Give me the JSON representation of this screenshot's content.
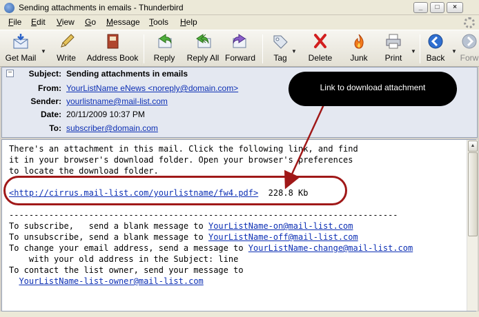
{
  "window": {
    "title": "Sending attachments in emails - Thunderbird",
    "minimize_glyph": "_",
    "maximize_glyph": "□",
    "close_glyph": "×"
  },
  "menu": [
    {
      "label": "File",
      "mnemonic": "F",
      "rest": "ile"
    },
    {
      "label": "Edit",
      "mnemonic": "E",
      "rest": "dit"
    },
    {
      "label": "View",
      "mnemonic": "V",
      "rest": "iew"
    },
    {
      "label": "Go",
      "mnemonic": "G",
      "rest": "o"
    },
    {
      "label": "Message",
      "mnemonic": "M",
      "rest": "essage"
    },
    {
      "label": "Tools",
      "mnemonic": "T",
      "rest": "ools"
    },
    {
      "label": "Help",
      "mnemonic": "H",
      "rest": "elp"
    }
  ],
  "toolbar": {
    "get_mail": "Get Mail",
    "write": "Write",
    "address_book": "Address Book",
    "reply": "Reply",
    "reply_all": "Reply All",
    "forward": "Forward",
    "tag": "Tag",
    "delete": "Delete",
    "junk": "Junk",
    "print": "Print",
    "back": "Back",
    "forward_nav": "Forw"
  },
  "header": {
    "subject_label": "Subject:",
    "subject": "Sending attachments in emails",
    "from_label": "From:",
    "from": "YourListName eNews <noreply@domain.com>",
    "sender_label": "Sender:",
    "sender": "yourlistname@mail-list.com",
    "date_label": "Date:",
    "date": "20/11/2009 10:37 PM",
    "to_label": "To:",
    "to": "subscriber@domain.com"
  },
  "body": {
    "line1": "There's an attachment in this mail. Click the following link, and find",
    "line2": "it in your browser's download folder. Open your browser's preferences",
    "line3": "to locate the download folder.",
    "attachment_link": "<http://cirrus.mail-list.com/yourlistname/fw4.pdf>",
    "attachment_size": "  228.8 Kb",
    "separator": "------------------------------------------------------------------------------",
    "subscribe_prefix": "To subscribe,   send a blank message to ",
    "subscribe_address": "YourListName-on@mail-list.com",
    "unsubscribe_prefix": "To unsubscribe, send a blank message to ",
    "unsubscribe_address": "YourListName-off@mail-list.com",
    "change_prefix": "To change your email address, send a message to ",
    "change_address": "YourListName-change@mail-list.com",
    "change_line2": "    with your old address in the Subject: line",
    "owner_line": "To contact the list owner, send your message to",
    "owner_address": "YourListName-list-owner@mail-list.com"
  },
  "annotation": {
    "callout": "Link to download attachment",
    "color": "#a01818"
  }
}
